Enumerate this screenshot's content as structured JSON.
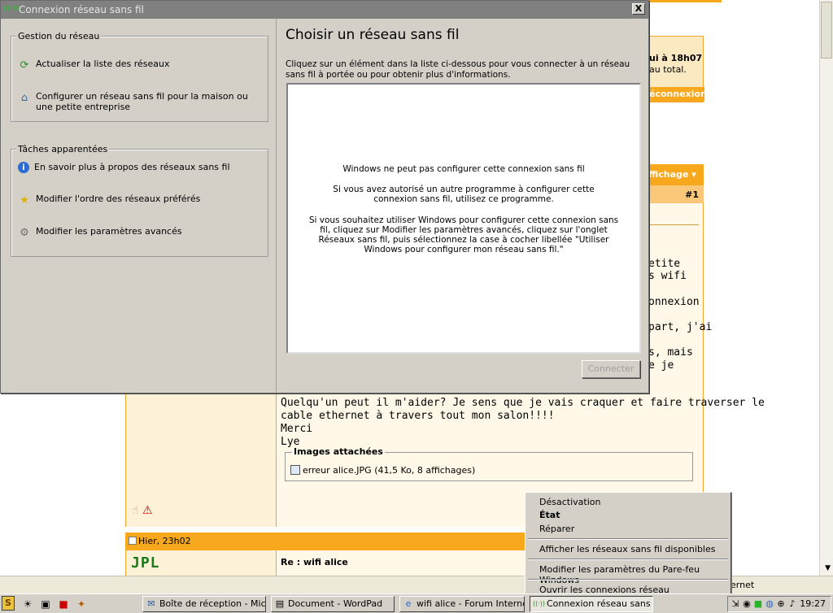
{
  "dialog": {
    "title": "Connexion réseau sans fil",
    "close_label": "X",
    "network_tasks": {
      "title": "Gestion du réseau",
      "items": [
        {
          "label": "Actualiser la liste des réseaux",
          "icon": "refresh-icon"
        },
        {
          "label": "Configurer un réseau sans fil pour la maison ou une petite entreprise",
          "icon": "wireless-setup-icon"
        }
      ]
    },
    "related_tasks": {
      "title": "Tâches apparentées",
      "items": [
        {
          "label": "En savoir plus à propos des réseaux sans fil",
          "icon": "info-icon"
        },
        {
          "label": "Modifier l'ordre des réseaux préférés",
          "icon": "star-icon"
        },
        {
          "label": "Modifier les paramètres avancés",
          "icon": "settings-icon"
        }
      ]
    },
    "heading": "Choisir un réseau sans fil",
    "description": "Cliquez sur un élément dans la liste ci-dessous pour vous connecter à un réseau sans fil à portée ou pour obtenir plus d'informations.",
    "message": {
      "line1": "Windows ne peut pas configurer cette connexion sans fil",
      "para2": "Si vous avez autorisé un autre programme à configurer cette connexion sans fil, utilisez ce programme.",
      "para3": "Si vous souhaitez utiliser Windows pour configurer cette connexion sans fil, cliquez sur Modifier les paramètres avancés, cliquez sur l'onglet Réseaux sans fil, puis sélectionnez la case à cocher libellée \"Utiliser Windows pour configurer mon réseau sans fil.\""
    },
    "connect_label": "Connecter"
  },
  "context_menu": {
    "items": [
      {
        "label": "Désactivation",
        "bold": false
      },
      {
        "label": "État",
        "bold": true
      },
      {
        "label": "Réparer",
        "bold": false
      },
      {
        "label": "Afficher les réseaux sans fil disponibles",
        "bold": false
      },
      {
        "label": "Modifier les paramètres du Pare-feu Windows",
        "bold": false
      },
      {
        "label": "Ouvrir les connexions réseau",
        "bold": false
      }
    ]
  },
  "background_page": {
    "banner_line1": "ui à 18h07",
    "banner_line2": "au total.",
    "banner_bar": "éconnexion",
    "post_header": "ffichage ▾",
    "post_number": "#1",
    "fragments": [
      "etite",
      "s wifi",
      "onnexion",
      "part, j'ai",
      "s, mais",
      "e je"
    ],
    "post_lines": [
      "Quelqu'un peut il m'aider? Je sens que je vais craquer et faire traverser le",
      "cable ethernet à travers tout mon salon!!!!",
      "Merci",
      "Lye"
    ],
    "attachments_title": "Images attachées",
    "attachment_file": "erreur alice.JPG (41,5 Ko, 8 affichages)",
    "next_post_date": "Hier, 23h02",
    "next_post_author": "JPL",
    "next_post_title": "Re : wifi alice",
    "status_text": "ernet"
  },
  "taskbar": {
    "buttons": [
      {
        "label": "Boîte de réception - Micr...",
        "icon": "outlook-icon"
      },
      {
        "label": "Document - WordPad",
        "icon": "wordpad-icon"
      },
      {
        "label": "wifi alice - Forum Interne...",
        "icon": "browser-icon"
      },
      {
        "label": "Connexion réseau sans fil",
        "icon": "wireless-icon"
      }
    ],
    "clock": "19:27"
  }
}
